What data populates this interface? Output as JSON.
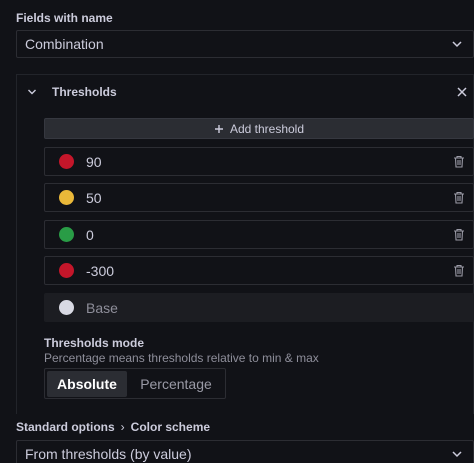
{
  "fields_section": {
    "label": "Fields with name",
    "select_value": "Combination"
  },
  "thresholds": {
    "title": "Thresholds",
    "add_label": "Add threshold",
    "items": [
      {
        "value": "90",
        "color": "#c4162a"
      },
      {
        "value": "50",
        "color": "#eab839"
      },
      {
        "value": "0",
        "color": "#299c46"
      },
      {
        "value": "-300",
        "color": "#c4162a"
      }
    ],
    "base": {
      "value": "Base",
      "color": "#d8d9e3"
    }
  },
  "thresholds_mode": {
    "title": "Thresholds mode",
    "description": "Percentage means thresholds relative to min & max",
    "options": [
      "Absolute",
      "Percentage"
    ],
    "selected": "Absolute"
  },
  "standard_options": {
    "breadcrumb_parent": "Standard options",
    "breadcrumb_separator": "›",
    "breadcrumb_child": "Color scheme",
    "select_value": "From thresholds (by value)"
  },
  "icons": {
    "chevron": "chevron-down-icon",
    "close": "close-icon",
    "plus": "plus-icon",
    "trash": "trash-icon"
  }
}
